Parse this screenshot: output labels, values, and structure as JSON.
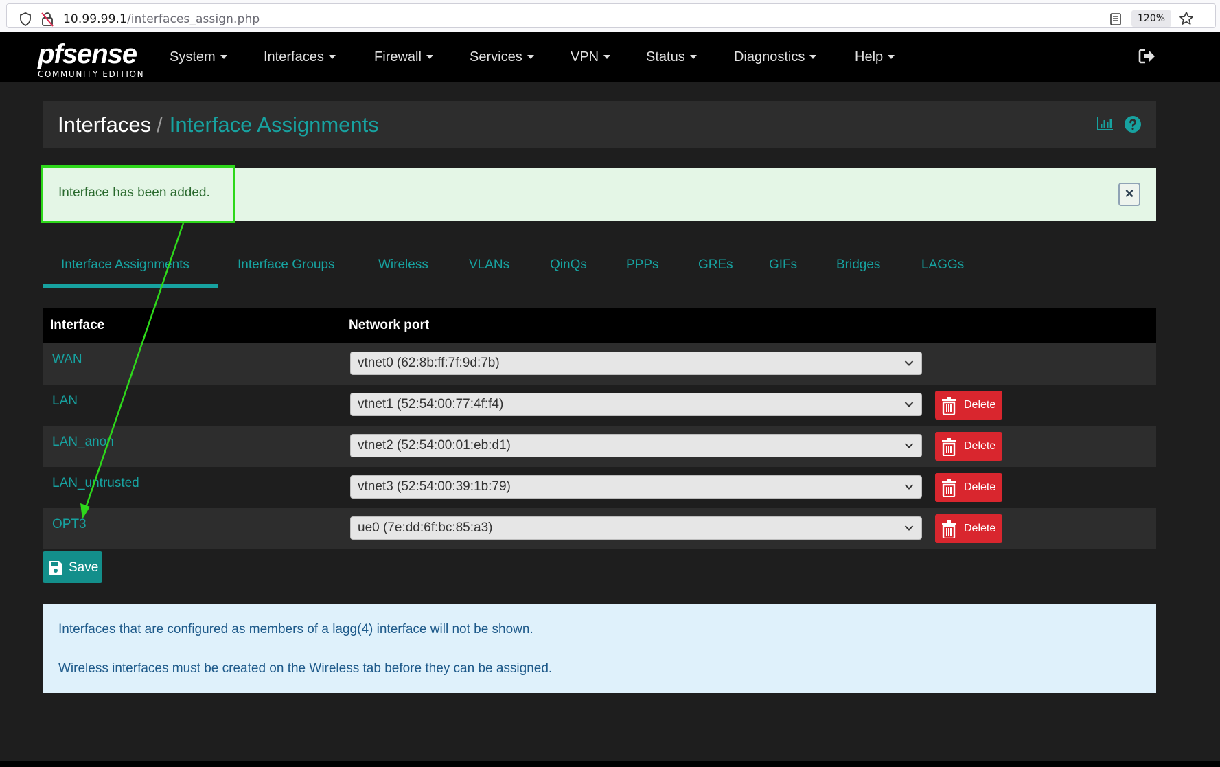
{
  "browser": {
    "url_host": "10.99.99.1",
    "url_path": "/interfaces_assign.php",
    "zoom": "120%"
  },
  "navbar": {
    "logo_text": "pfsense",
    "logo_sub": "COMMUNITY EDITION",
    "items": [
      {
        "label": "System"
      },
      {
        "label": "Interfaces"
      },
      {
        "label": "Firewall"
      },
      {
        "label": "Services"
      },
      {
        "label": "VPN"
      },
      {
        "label": "Status"
      },
      {
        "label": "Diagnostics"
      },
      {
        "label": "Help"
      }
    ]
  },
  "breadcrumb": {
    "parent": "Interfaces",
    "separator": "/",
    "current": "Interface Assignments"
  },
  "alert": {
    "message": "Interface has been added.",
    "close": "×"
  },
  "tabs": [
    {
      "label": "Interface Assignments",
      "active": true
    },
    {
      "label": "Interface Groups"
    },
    {
      "label": "Wireless"
    },
    {
      "label": "VLANs"
    },
    {
      "label": "QinQs"
    },
    {
      "label": "PPPs"
    },
    {
      "label": "GREs"
    },
    {
      "label": "GIFs"
    },
    {
      "label": "Bridges"
    },
    {
      "label": "LAGGs"
    }
  ],
  "table": {
    "headers": {
      "interface": "Interface",
      "network_port": "Network port"
    },
    "rows": [
      {
        "interface": "WAN",
        "port": "vtnet0 (62:8b:ff:7f:9d:7b)",
        "delete": ""
      },
      {
        "interface": "LAN",
        "port": "vtnet1 (52:54:00:77:4f:f4)",
        "delete": "Delete"
      },
      {
        "interface": "LAN_anon",
        "port": "vtnet2 (52:54:00:01:eb:d1)",
        "delete": "Delete"
      },
      {
        "interface": "LAN_untrusted",
        "port": "vtnet3 (52:54:00:39:1b:79)",
        "delete": "Delete"
      },
      {
        "interface": "OPT3",
        "port": "ue0 (7e:dd:6f:bc:85:a3)",
        "delete": "Delete"
      }
    ]
  },
  "save_label": "Save",
  "info": {
    "line1": "Interfaces that are configured as members of a lagg(4) interface will not be shown.",
    "line2": "Wireless interfaces must be created on the Wireless tab before they can be assigned."
  },
  "colors": {
    "accent": "#17a2a0",
    "annotation": "#2ed81b",
    "danger": "#d9262e"
  }
}
